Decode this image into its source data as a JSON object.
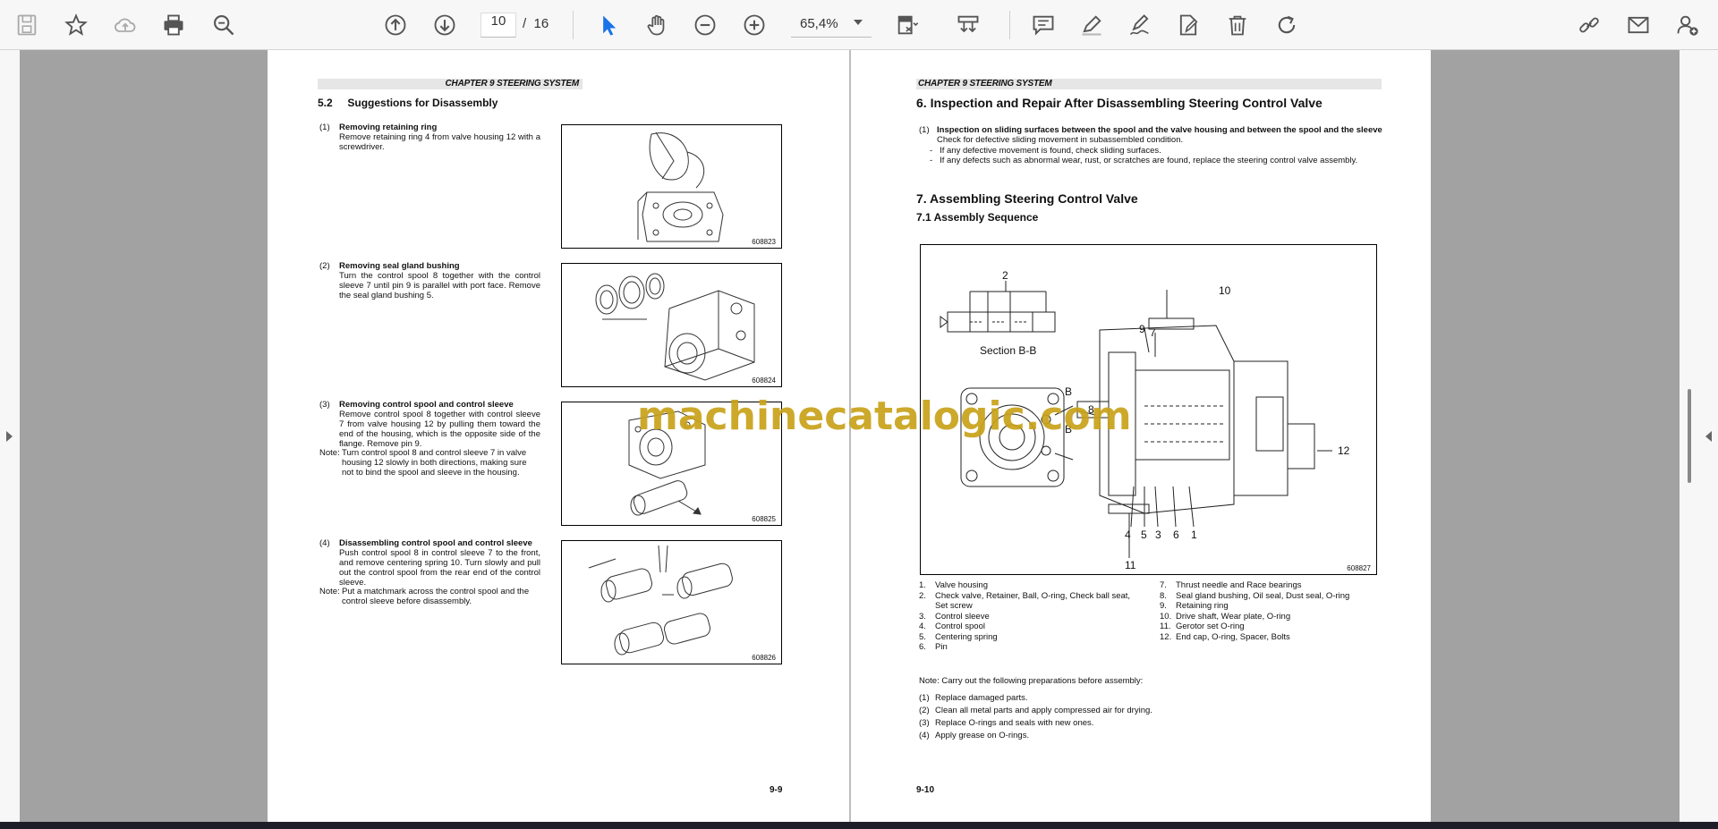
{
  "toolbar": {
    "current_page": "10",
    "page_sep": "/",
    "total_pages": "16",
    "zoom": "65,4%"
  },
  "left_page": {
    "chapter": "CHAPTER 9 STEERING SYSTEM",
    "section_num": "5.2",
    "section_title": "Suggestions for Disassembly",
    "steps": [
      {
        "num": "(1)",
        "title": "Removing retaining ring",
        "body": "Remove retaining ring 4 from valve housing 12 with a screwdriver.",
        "fig": "608823"
      },
      {
        "num": "(2)",
        "title": "Removing seal gland bushing",
        "body": "Turn the control spool 8 together with the control sleeve 7 until pin 9 is parallel with port face. Remove the seal gland bushing 5.",
        "fig": "608824"
      },
      {
        "num": "(3)",
        "title": "Removing control spool and control sleeve",
        "body": "Remove control spool 8 together with control sleeve 7 from valve housing 12 by pulling them toward the end of the housing, which is the opposite side of the flange. Remove pin 9.",
        "note_label": "Note:",
        "note": "Turn control spool 8 and control sleeve 7 in valve housing 12 slowly in both directions, making sure not to bind the spool and sleeve in the housing.",
        "fig": "608825"
      },
      {
        "num": "(4)",
        "title": "Disassembling control spool and control sleeve",
        "body": "Push control spool 8 in control sleeve 7 to the front, and remove centering spring 10. Turn slowly and pull out the control spool from the rear end of the control sleeve.",
        "note_label": "Note:",
        "note": "Put a matchmark across the control spool and the control sleeve before disassembly.",
        "fig": "608826"
      }
    ],
    "page_number": "9-9"
  },
  "right_page": {
    "chapter": "CHAPTER 9 STEERING SYSTEM",
    "s6_title": "6.    Inspection and Repair After Disassembling Steering Control Valve",
    "s6_item_num": "(1)",
    "s6_item_title": "Inspection on sliding surfaces between the spool and the valve housing and between the spool and the sleeve",
    "s6_item_body": "Check for defective sliding movement in subassembled condition.",
    "s6_bullets": [
      "If any defective movement is found, check sliding surfaces.",
      "If any defects such as abnormal wear, rust, or scratches are found, replace the steering control valve assembly."
    ],
    "s7_title": "7.    Assembling Steering Control Valve",
    "s71_title": "7.1      Assembly Sequence",
    "fig": {
      "code": "608827",
      "section_label": "Section B-B",
      "callouts": [
        "2",
        "10",
        "9",
        "7",
        "B",
        "B",
        "8",
        "12",
        "4",
        "5",
        "3",
        "6",
        "1",
        "11"
      ]
    },
    "parts_left": [
      {
        "n": "1.",
        "t": "Valve housing"
      },
      {
        "n": "2.",
        "t": "Check valve, Retainer, Ball, O-ring, Check ball seat,"
      },
      {
        "n": "",
        "t": "Set screw"
      },
      {
        "n": "3.",
        "t": "Control sleeve"
      },
      {
        "n": "4.",
        "t": "Control spool"
      },
      {
        "n": "5.",
        "t": "Centering spring"
      },
      {
        "n": "6.",
        "t": "Pin"
      }
    ],
    "parts_right": [
      {
        "n": "7.",
        "t": "Thrust needle and Race bearings"
      },
      {
        "n": "8.",
        "t": "Seal gland bushing, Oil seal, Dust seal, O-ring"
      },
      {
        "n": "9.",
        "t": "Retaining ring"
      },
      {
        "n": "10.",
        "t": "Drive shaft, Wear plate, O-ring"
      },
      {
        "n": "11.",
        "t": "Gerotor set O-ring"
      },
      {
        "n": "12.",
        "t": "End cap, O-ring, Spacer, Bolts"
      }
    ],
    "prep_note": "Note: Carry out the following preparations before assembly:",
    "prep_items": [
      {
        "n": "(1)",
        "t": "Replace damaged parts."
      },
      {
        "n": "(2)",
        "t": "Clean all metal parts and apply compressed air for drying."
      },
      {
        "n": "(3)",
        "t": "Replace O-rings and seals with new ones."
      },
      {
        "n": "(4)",
        "t": "Apply grease on O-rings."
      }
    ],
    "page_number": "9-10"
  },
  "watermark": "machinecatalogic.com",
  "icons": {
    "accent": "#1a73e8",
    "toolbar_icon": "#555555"
  }
}
